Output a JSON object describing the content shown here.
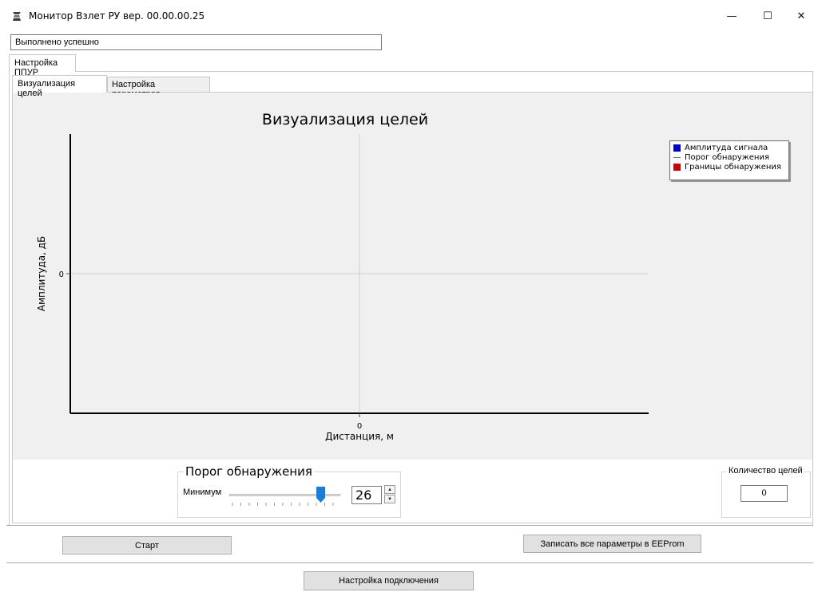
{
  "window": {
    "title": "Монитор Взлет РУ вер. 00.00.00.25",
    "min_glyph": "—",
    "max_glyph": "☐",
    "close_glyph": "✕"
  },
  "status": {
    "value": "Выполнено успешно"
  },
  "tabs": {
    "outer": [
      "Настройка ППУР"
    ],
    "inner": [
      "Визуализация целей",
      "Настройка параметров"
    ],
    "active_inner": "Визуализация целей"
  },
  "chart_data": {
    "type": "line",
    "title": "Визуализация целей",
    "xlabel": "Дистанция, м",
    "ylabel": "Амплитуда, дБ",
    "x_ticks": [
      "0"
    ],
    "y_ticks": [
      "0"
    ],
    "grid": true,
    "legend_position": "top-right",
    "series": [
      {
        "name": "Амплитуда сигнала",
        "values": [],
        "color": "#0000cc"
      },
      {
        "name": "Порог обнаружения",
        "values": [],
        "color": "#4a8a4a"
      },
      {
        "name": "Границы обнаружения",
        "values": [],
        "color": "#cc0000"
      }
    ]
  },
  "threshold": {
    "title": "Порог обнаружения",
    "min_label": "Минимум",
    "value": "26",
    "slider_level": 0.87,
    "spin_up": "▲",
    "spin_down": "▼"
  },
  "targets": {
    "title": "Количество целей",
    "value": "0"
  },
  "buttons": {
    "start": "Старт",
    "eeprom": "Записать все параметры в EEProm",
    "connect": "Настройка подключения"
  },
  "colors": {
    "chart_bg": "#f0f0f0",
    "button_bg": "#e1e1e1",
    "slider_thumb": "#1e7bd6"
  }
}
